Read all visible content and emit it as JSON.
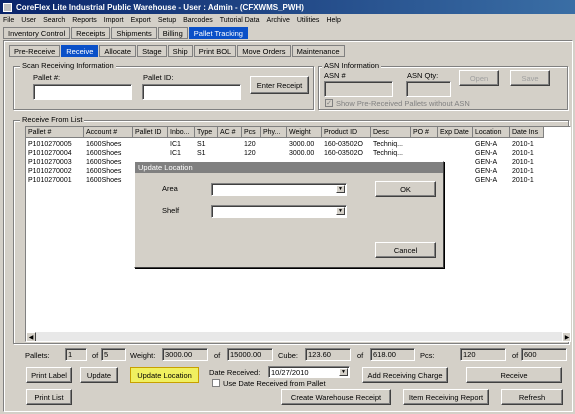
{
  "window": {
    "title": "CoreFlex Lite Industrial Public Warehouse - User : Admin - (CFXWMS_PWH)"
  },
  "menu": [
    "File",
    "User",
    "Search",
    "Reports",
    "Import",
    "Export",
    "Setup",
    "Barcodes",
    "Tutorial Data",
    "Archive",
    "Utilities",
    "Help"
  ],
  "top_tabs": [
    "Inventory Control",
    "Receipts",
    "Shipments",
    "Billing",
    "Pallet Tracking"
  ],
  "top_tabs_active": "Pallet Tracking",
  "sub_tabs": [
    "Pre-Receive",
    "Receive",
    "Allocate",
    "Stage",
    "Ship",
    "Print BOL",
    "Move Orders",
    "Maintenance"
  ],
  "sub_tabs_active": "Receive",
  "scan": {
    "group_label": "Scan Receiving Information",
    "pallet_label": "Pallet #:",
    "pallet_value": "",
    "pallet_id_label": "Pallet ID:",
    "pallet_id_value": "",
    "enter_button": "Enter Receipt"
  },
  "asn": {
    "group_label": "ASN Information",
    "asn_label": "ASN #",
    "asn_value": "",
    "qty_label": "ASN Qty:",
    "qty_value": "",
    "open_button": "Open",
    "save_button": "Save",
    "checkbox_label": "Show Pre-Received Pallets without ASN"
  },
  "list": {
    "group_label": "Receive From List",
    "columns": [
      "Pallet #",
      "Account #",
      "Pallet ID",
      "Inbo...",
      "Type",
      "AC #",
      "Pcs",
      "Phy...",
      "Weight",
      "Product ID",
      "Desc",
      "PO #",
      "Exp Date",
      "Location",
      "Date Ins"
    ],
    "rows": [
      [
        "P1010270005",
        "1600Shoes",
        "",
        "IC1",
        "S1",
        "",
        "120",
        "",
        "3000.00",
        "160-03502O",
        "Techniq...",
        "",
        "",
        "GEN-A",
        "2010-1"
      ],
      [
        "P1010270004",
        "1600Shoes",
        "",
        "IC1",
        "S1",
        "",
        "120",
        "",
        "3000.00",
        "160-03502O",
        "Techniq...",
        "",
        "",
        "GEN-A",
        "2010-1"
      ],
      [
        "P1010270003",
        "1600Shoes",
        "",
        "",
        "",
        "",
        "",
        "",
        "",
        "",
        "",
        "",
        "",
        "GEN-A",
        "2010-1"
      ],
      [
        "P1010270002",
        "1600Shoes",
        "",
        "",
        "",
        "",
        "",
        "",
        "",
        "",
        "",
        "",
        "",
        "GEN-A",
        "2010-1"
      ],
      [
        "P1010270001",
        "1600Shoes",
        "",
        "",
        "",
        "",
        "",
        "",
        "",
        "",
        "",
        "",
        "",
        "GEN-A",
        "2010-1"
      ]
    ]
  },
  "dialog": {
    "title": "Update Location",
    "area_label": "Area",
    "area_value": "",
    "shelf_label": "Shelf",
    "shelf_value": "",
    "ok_button": "OK",
    "cancel_button": "Cancel"
  },
  "summary": {
    "pallets_label": "Pallets:",
    "pallets_value": "1",
    "of1": "of",
    "pallets_total": "5",
    "weight_label": "Weight:",
    "weight_value": "3000.00",
    "of2": "of",
    "weight_total": "15000.00",
    "cube_label": "Cube:",
    "cube_value": "123.60",
    "of3": "of",
    "cube_total": "618.00",
    "pcs_label": "Pcs:",
    "pcs_value": "120",
    "of4": "of",
    "pcs_total": "600"
  },
  "actions": {
    "print_label": "Print Label",
    "update": "Update",
    "update_location": "Update Location",
    "date_received_label": "Date Received:",
    "date_received_value": "10/27/2010",
    "use_date_label": "Use Date Received from Pallet",
    "add_charge": "Add Receiving Charge",
    "receive": "Receive",
    "print_list": "Print List",
    "create_receipt": "Create Warehouse Receipt",
    "item_report": "Item Receiving Report",
    "refresh": "Refresh"
  }
}
